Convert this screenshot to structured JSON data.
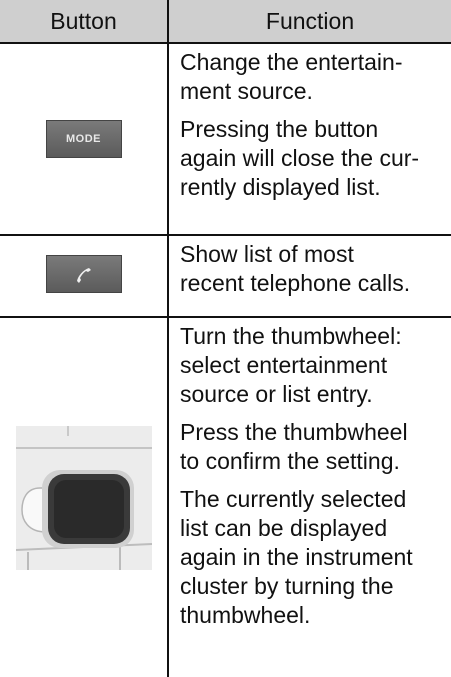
{
  "header": {
    "col_button": "Button",
    "col_function": "Function"
  },
  "rows": [
    {
      "button_label": "MODE",
      "button_icon": "mode-button",
      "paragraphs": [
        "Change the entertain-\nment source.",
        "Pressing the button\nagain will close the cur-\nrently displayed list."
      ]
    },
    {
      "button_icon": "telephone-handset-icon",
      "paragraphs": [
        "Show list of most\nrecent telephone calls."
      ]
    },
    {
      "button_icon": "thumbwheel-photo",
      "paragraphs": [
        "Turn the thumbwheel:\nselect entertainment\nsource or list entry.",
        "Press the thumbwheel\nto confirm the setting.",
        "The currently selected\nlist can be displayed\nagain in the instrument\ncluster by turning the\nthumbwheel."
      ]
    }
  ],
  "colors": {
    "header_bg": "#cfcfcf",
    "button_bg": "#666666"
  }
}
